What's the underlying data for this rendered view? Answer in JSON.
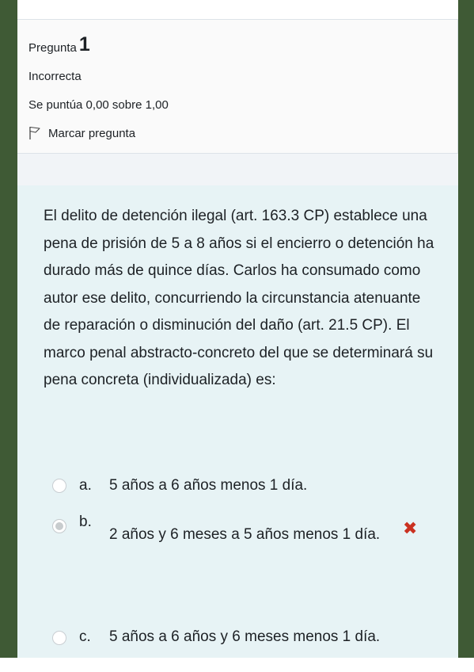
{
  "question": {
    "label": "Pregunta",
    "number": "1",
    "state": "Incorrecta",
    "grade": "Se puntúa 0,00 sobre 1,00",
    "flag_label": "Marcar pregunta",
    "text": "El delito de detención ilegal (art. 163.3 CP) establece una pena de prisión de 5 a 8 años si el encierro o detención ha durado más de quince días. Carlos ha consumado como autor ese delito, concurriendo la circunstancia atenuante de reparación o disminución del daño (art. 21.5 CP). El marco penal abstracto-concreto del que se determinará su pena concreta (individualizada) es:"
  },
  "answers": [
    {
      "letter": "a.",
      "text": "5 años a 6 años menos 1 día.",
      "selected": false
    },
    {
      "letter": "b.",
      "text": "2 años y 6 meses a 5 años menos 1 día.",
      "selected": true,
      "mark": "incorrect"
    },
    {
      "letter": "c.",
      "text": "5 años a 6 años y 6 meses menos 1 día.",
      "selected": false
    }
  ],
  "colors": {
    "side_border": "#3f5a35",
    "content_bg": "#e7f3f5",
    "incorrect_mark": "#ca3120"
  }
}
